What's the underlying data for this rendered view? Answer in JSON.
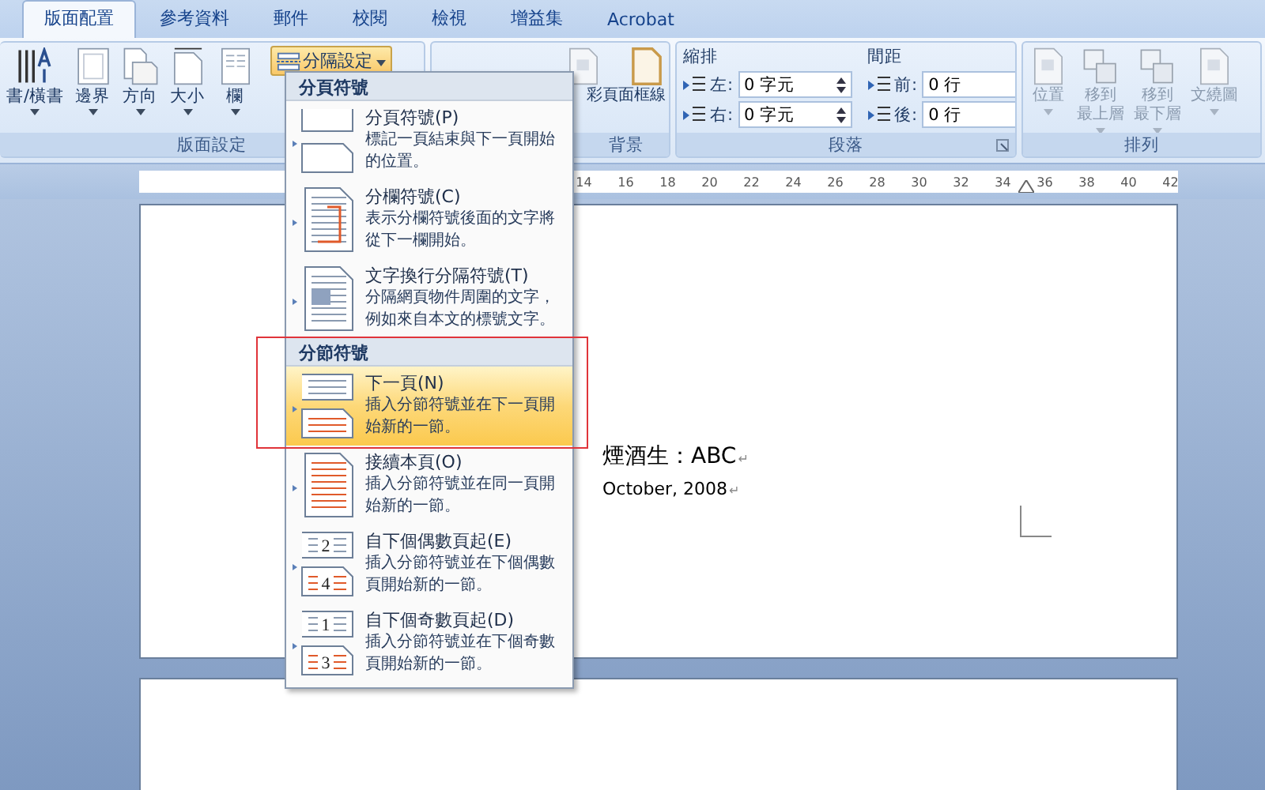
{
  "tabs": [
    {
      "label": "版面配置",
      "selected": true
    },
    {
      "label": "參考資料",
      "selected": false
    },
    {
      "label": "郵件",
      "selected": false
    },
    {
      "label": "校閱",
      "selected": false
    },
    {
      "label": "檢視",
      "selected": false
    },
    {
      "label": "增益集",
      "selected": false
    },
    {
      "label": "Acrobat",
      "selected": false
    }
  ],
  "ribbon": {
    "groups": [
      {
        "kind": "buttons",
        "label": "版面設定",
        "disabled": false,
        "buttons": [
          {
            "lines": [
              "書/橫書"
            ],
            "dropdown": true
          },
          {
            "lines": [
              "邊界"
            ],
            "dropdown": true
          },
          {
            "lines": [
              "方向"
            ],
            "dropdown": true
          },
          {
            "lines": [
              "大小"
            ],
            "dropdown": true
          },
          {
            "lines": [
              "欄"
            ],
            "dropdown": true
          }
        ],
        "split_button": {
          "label": "分隔設定",
          "open": true
        }
      },
      {
        "kind": "buttons",
        "label": "背景",
        "disabled": false,
        "buttons": [
          {
            "lines": [
              "彩"
            ],
            "dropdown": false
          },
          {
            "lines": [
              "頁面框線"
            ],
            "dropdown": false
          }
        ]
      },
      {
        "kind": "paragraph",
        "label": "段落",
        "columns": [
          {
            "title": "縮排",
            "fields": [
              {
                "label": "左:",
                "value": "0 字元"
              },
              {
                "label": "右:",
                "value": "0 字元"
              }
            ]
          },
          {
            "title": "間距",
            "fields": [
              {
                "label": "前:",
                "value": "0 行"
              },
              {
                "label": "後:",
                "value": "0 行"
              }
            ]
          }
        ]
      },
      {
        "kind": "buttons",
        "label": "排列",
        "disabled": true,
        "buttons": [
          {
            "lines": [
              "位置"
            ],
            "dropdown": true
          },
          {
            "lines": [
              "移到",
              "最上層"
            ],
            "dropdown": true
          },
          {
            "lines": [
              "移到",
              "最下層"
            ],
            "dropdown": true
          },
          {
            "lines": [
              "文繞圖"
            ],
            "dropdown": true
          }
        ]
      }
    ]
  },
  "ruler": {
    "labels": [
      "14",
      "16",
      "18",
      "20",
      "22",
      "24",
      "26",
      "28",
      "30",
      "32",
      "34",
      "36",
      "38",
      "40",
      "42"
    ]
  },
  "document": {
    "lines": [
      {
        "kind": "title",
        "text": "煙酒生：ABC",
        "mark": "↵"
      },
      {
        "kind": "date",
        "text": "October, 2008",
        "mark": "↵"
      }
    ]
  },
  "menu": {
    "sections": [
      {
        "title": "分頁符號",
        "items": [
          {
            "title": "分頁符號(P)",
            "description": "標記一頁結束與下一頁開始的位置。",
            "kind": "page",
            "selected": false
          },
          {
            "title": "分欄符號(C)",
            "description": "表示分欄符號後面的文字將從下一欄開始。",
            "kind": "column",
            "selected": false
          },
          {
            "title": "文字換行分隔符號(T)",
            "description": "分隔網頁物件周圍的文字，例如來自本文的標號文字。",
            "kind": "wrap",
            "selected": false
          }
        ]
      },
      {
        "title": "分節符號",
        "items": [
          {
            "title": "下一頁(N)",
            "description": "插入分節符號並在下一頁開始新的一節。",
            "kind": "section",
            "selected": true
          },
          {
            "title": "接續本頁(O)",
            "description": "插入分節符號並在同一頁開始新的一節。",
            "kind": "continuous",
            "selected": false
          },
          {
            "title": "自下個偶數頁起(E)",
            "description": "插入分節符號並在下個偶數頁開始新的一節。",
            "kind": "numbered",
            "icon_numbers": [
              "2",
              "4"
            ],
            "selected": false
          },
          {
            "title": "自下個奇數頁起(D)",
            "description": "插入分節符號並在下個奇數頁開始新的一節。",
            "kind": "numbered",
            "icon_numbers": [
              "1",
              "3"
            ],
            "selected": false
          }
        ]
      }
    ]
  }
}
